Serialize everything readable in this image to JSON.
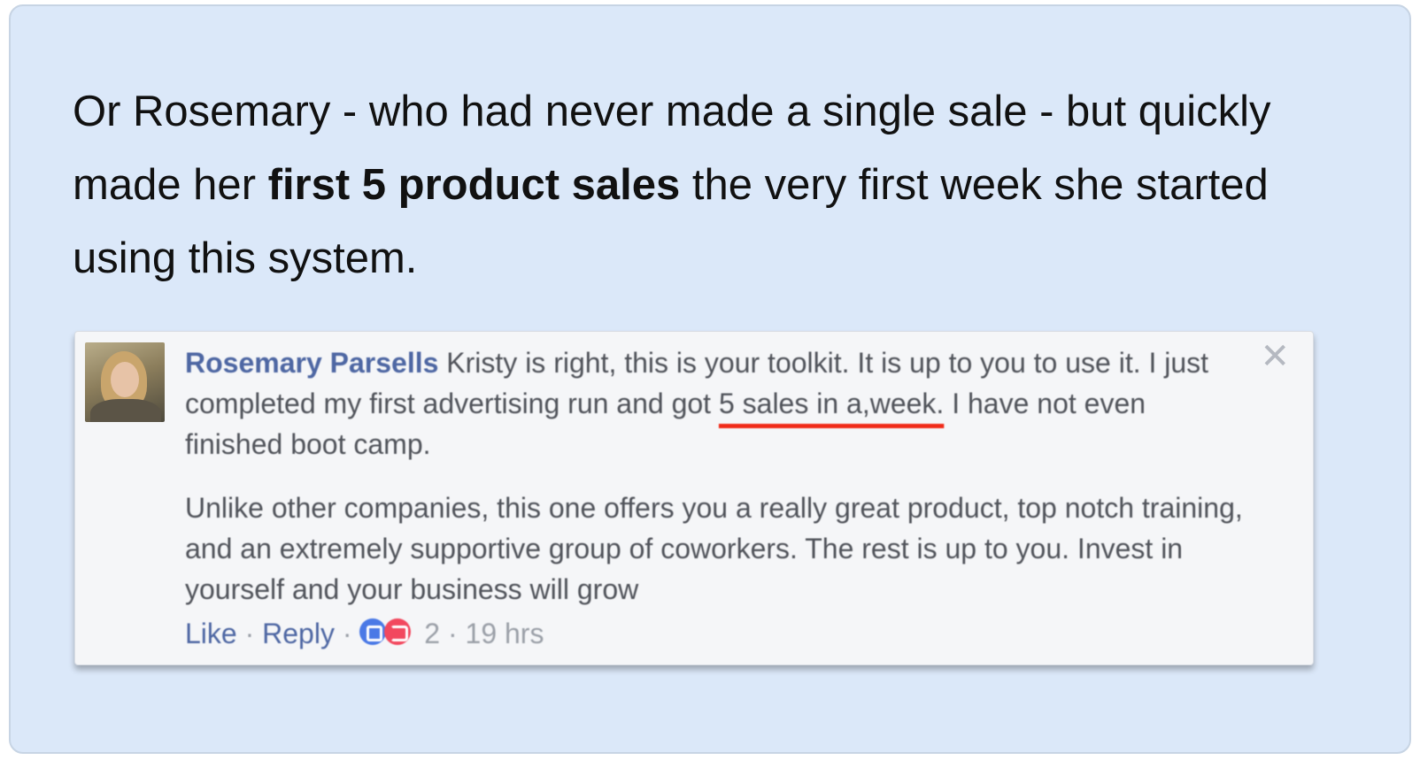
{
  "intro": {
    "before_bold": "Or Rosemary - who had never made a single sale - but quickly made her ",
    "bold": "first 5 product sales",
    "after_bold": " the very first week she started using this system."
  },
  "comment": {
    "author": "Rosemary Parsells",
    "p1_part1": " Kristy is right, this is your toolkit. It is up to you to use it. I just completed my first advertising run and got ",
    "p1_underlined": "5 sales in a,week.",
    "p1_part2": " I have not even finished boot camp.",
    "p2": "Unlike other companies, this one offers you a really great product, top notch training, and an extremely supportive group of coworkers. The rest is up to you. Invest in yourself and your business will grow",
    "close_glyph": "✕",
    "actions": {
      "like": "Like",
      "reply": "Reply",
      "separator": " · ",
      "reaction_count": "2",
      "time": "19 hrs"
    },
    "icons": [
      "like-reaction-icon",
      "love-reaction-icon",
      "close-icon",
      "avatar"
    ],
    "colors": {
      "link": "#4e67a3",
      "underline": "#f02b19",
      "panel_bg": "#dbe8f9",
      "comment_bg": "#f5f6f8"
    }
  }
}
